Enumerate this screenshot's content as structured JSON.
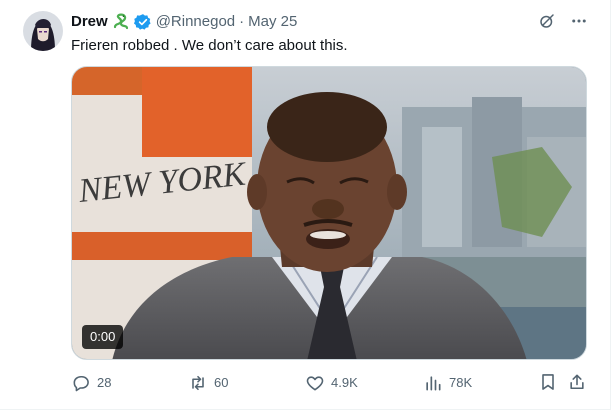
{
  "tweet": {
    "display_name": "Drew",
    "handle": "@Rinnegod",
    "separator": "·",
    "date": "May 25",
    "text": "Frieren robbed . We don’t care about this.",
    "video_time": "0:00",
    "video_caption_text": "NEW YORK"
  },
  "actions": {
    "replies": "28",
    "reposts": "60",
    "likes": "4.9K",
    "views": "78K"
  },
  "icons": {
    "emoji": "snake-emoji",
    "verified": "verified-badge-icon",
    "grok": "grok-icon",
    "more": "more-icon",
    "reply": "reply-icon",
    "repost": "repost-icon",
    "like": "like-icon",
    "views": "views-icon",
    "bookmark": "bookmark-icon",
    "share": "share-icon"
  },
  "colors": {
    "text": "#0f1419",
    "muted": "#536471",
    "verified": "#1d9bf0",
    "border": "#cfd9de"
  }
}
